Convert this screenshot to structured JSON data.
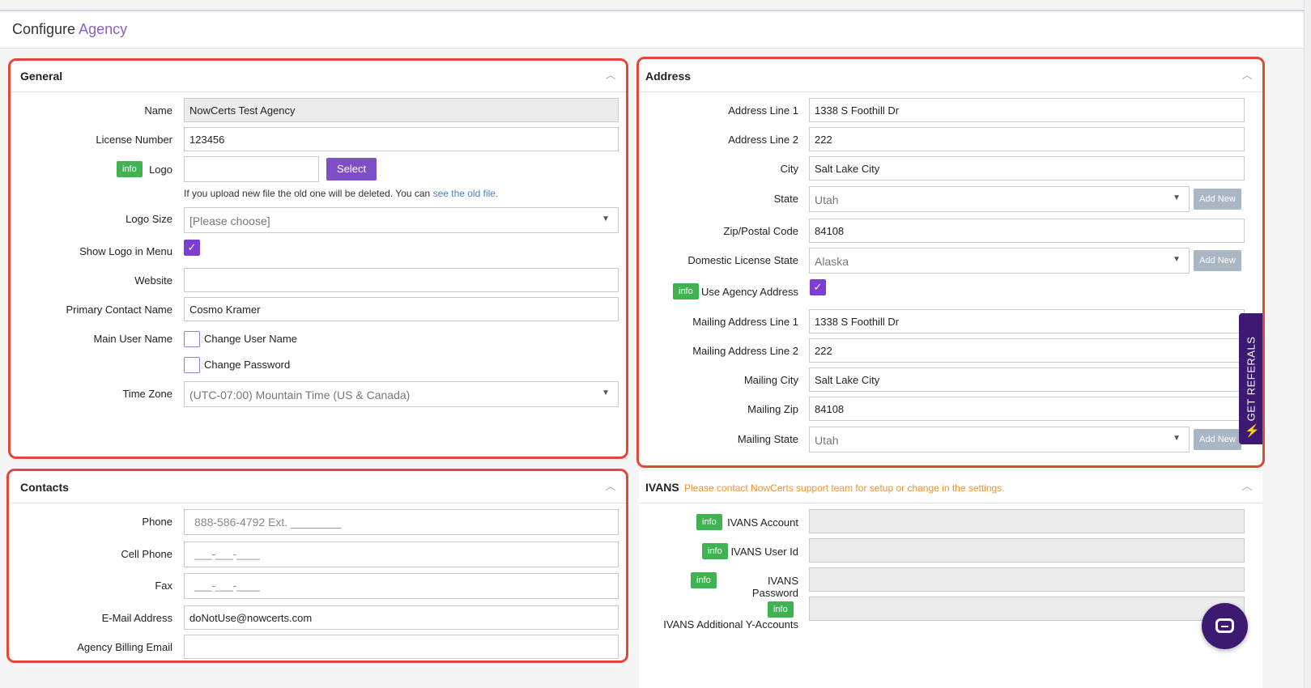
{
  "page": {
    "title_prefix": "Configure",
    "title_accent": "Agency"
  },
  "general": {
    "title": "General",
    "name_label": "Name",
    "name_value": "NowCerts Test Agency",
    "license_label": "License Number",
    "license_value": "123456",
    "info_label": "info",
    "logo_label": "Logo",
    "logo_value": "",
    "select_label": "Select",
    "help_text": "If you upload new file the old one will be deleted. You can ",
    "help_link": "see the old file.",
    "logo_size_label": "Logo Size",
    "logo_size_value": "[Please choose]",
    "show_logo_label": "Show Logo in Menu",
    "show_logo_checked": true,
    "website_label": "Website",
    "website_value": "",
    "primary_contact_label": "Primary Contact Name",
    "primary_contact_value": "Cosmo Kramer",
    "main_user_label": "Main User Name",
    "change_user_label": "Change User Name",
    "change_user_checked": false,
    "change_password_label": "Change Password",
    "change_password_checked": false,
    "timezone_label": "Time Zone",
    "timezone_value": "(UTC-07:00) Mountain Time (US & Canada)"
  },
  "contacts": {
    "title": "Contacts",
    "phone_label": "Phone",
    "phone_placeholder": "888-586-4792 Ext. ________",
    "cell_label": "Cell Phone",
    "cell_placeholder": "___-___-____",
    "fax_label": "Fax",
    "fax_placeholder": "___-___-____",
    "email_label": "E-Mail Address",
    "email_value": "doNotUse@nowcerts.com",
    "billing_label": "Agency Billing Email",
    "billing_value": ""
  },
  "address": {
    "title": "Address",
    "line1_label": "Address Line 1",
    "line1_value": "1338 S Foothill Dr",
    "line2_label": "Address Line 2",
    "line2_value": "222",
    "city_label": "City",
    "city_value": "Salt Lake City",
    "state_label": "State",
    "state_value": "Utah",
    "add_new_label": "Add New",
    "zip_label": "Zip/Postal Code",
    "zip_value": "84108",
    "dls_label": "Domestic License State",
    "dls_value": "Alaska",
    "info_label": "info",
    "use_agency_label": "Use Agency Address",
    "use_agency_checked": true,
    "mline1_label": "Mailing Address Line 1",
    "mline1_value": "1338 S Foothill Dr",
    "mline2_label": "Mailing Address Line 2",
    "mline2_value": "222",
    "mcity_label": "Mailing City",
    "mcity_value": "Salt Lake City",
    "mzip_label": "Mailing Zip",
    "mzip_value": "84108",
    "mstate_label": "Mailing State",
    "mstate_value": "Utah"
  },
  "ivans": {
    "title": "IVANS",
    "note": "Please contact NowCerts support team for setup or change in the settings.",
    "info_label": "info",
    "account_label": "IVANS Account",
    "userid_label": "IVANS User Id",
    "password_label": "IVANS Password",
    "additional_label": "IVANS Additional Y-Accounts"
  },
  "widgets": {
    "referrals_label": "GET REFERALS"
  },
  "colors": {
    "accent_purple": "#7d4fc8",
    "info_green": "#3fb34f",
    "highlight_red": "#e0483a",
    "note_orange": "#f0922d"
  }
}
